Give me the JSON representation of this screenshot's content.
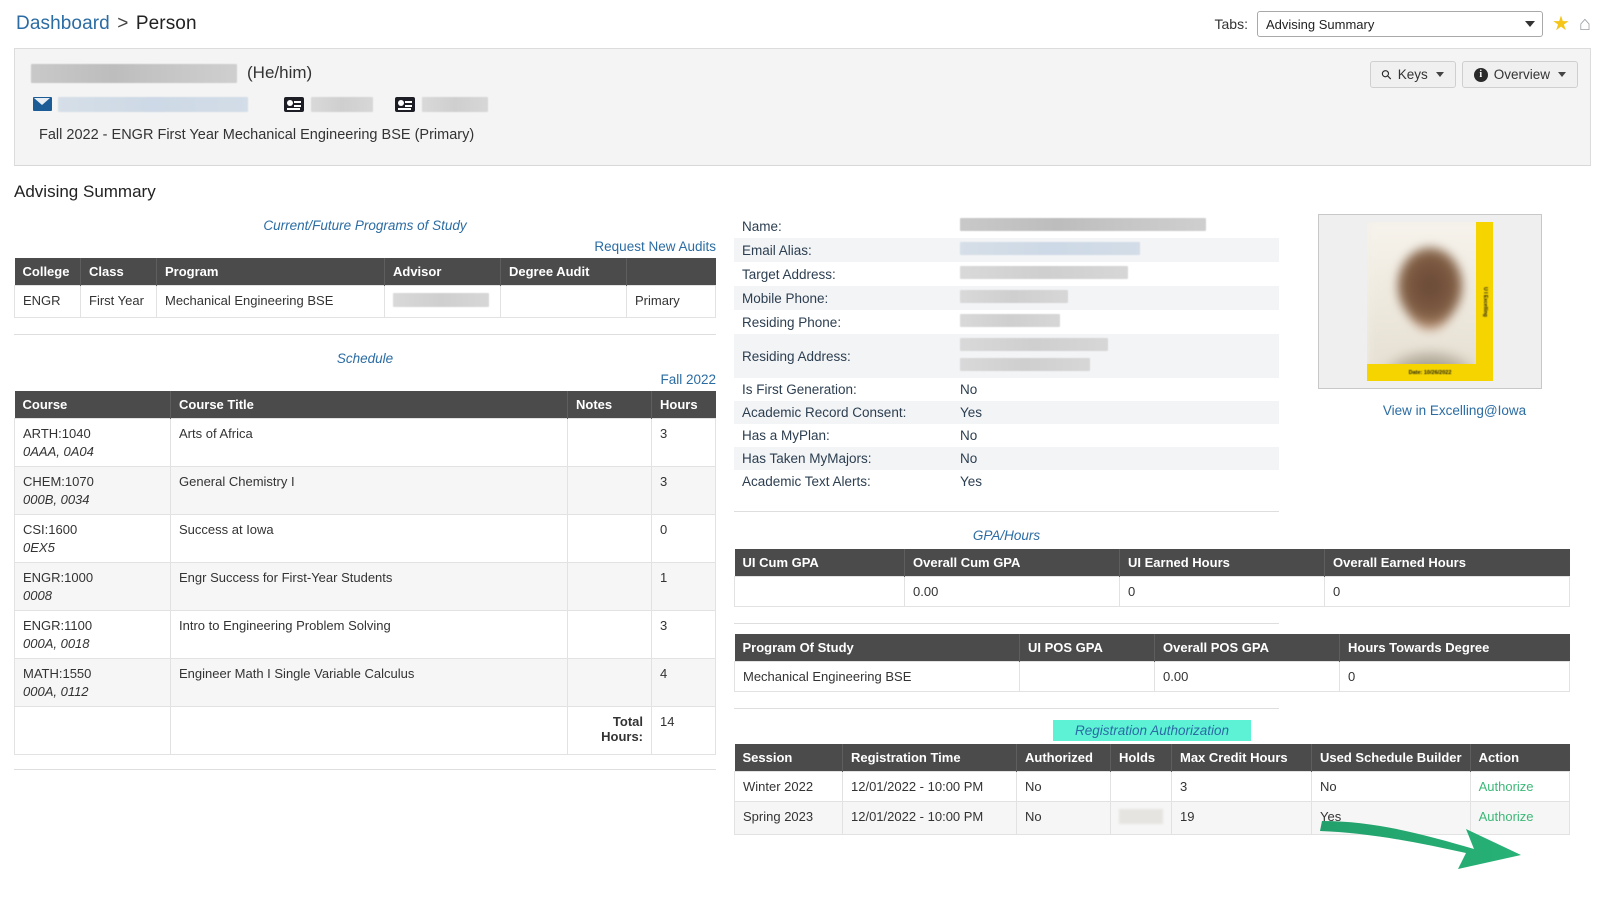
{
  "breadcrumb": {
    "root": "Dashboard",
    "separator": ">",
    "current": "Person"
  },
  "topbar": {
    "tabs_label": "Tabs:",
    "tabs_selected": "Advising Summary",
    "tabs_options": [
      "Advising Summary"
    ],
    "favorite_icon": "star-icon",
    "home_icon": "home-icon"
  },
  "person": {
    "name_redacted": "",
    "pronouns": "(He/him)",
    "email_icon": "envelope-icon",
    "id_icon_1": "id-card-icon",
    "id_icon_2": "id-card-icon",
    "program_line": "Fall 2022 - ENGR First Year Mechanical Engineering BSE (Primary)",
    "keys_button": "Keys",
    "overview_button": "Overview"
  },
  "page": {
    "title": "Advising Summary"
  },
  "programs": {
    "caption": "Current/Future Programs of Study",
    "request_link": "Request New Audits",
    "headers": [
      "College",
      "Class",
      "Program",
      "Advisor",
      "Degree Audit",
      ""
    ],
    "rows": [
      {
        "college": "ENGR",
        "class": "First Year",
        "program": "Mechanical Engineering BSE",
        "advisor": "",
        "degree_audit": "",
        "primary": "Primary"
      }
    ]
  },
  "schedule": {
    "caption": "Schedule",
    "term_link": "Fall 2022",
    "headers": [
      "Course",
      "Course Title",
      "Notes",
      "Hours"
    ],
    "rows": [
      {
        "code": "ARTH:1040",
        "section": "0AAA, 0A04",
        "title": "Arts of Africa",
        "notes": "",
        "hours": "3"
      },
      {
        "code": "CHEM:1070",
        "section": "000B, 0034",
        "title": "General Chemistry I",
        "notes": "",
        "hours": "3"
      },
      {
        "code": "CSI:1600",
        "section": "0EX5",
        "title": "Success at Iowa",
        "notes": "",
        "hours": "0"
      },
      {
        "code": "ENGR:1000",
        "section": "0008",
        "title": "Engr Success for First-Year Students",
        "notes": "",
        "hours": "1"
      },
      {
        "code": "ENGR:1100",
        "section": "000A, 0018",
        "title": "Intro to Engineering Problem Solving",
        "notes": "",
        "hours": "3"
      },
      {
        "code": "MATH:1550",
        "section": "000A, 0112",
        "title": "Engineer Math I Single Variable Calculus",
        "notes": "",
        "hours": "4"
      }
    ],
    "total_label": "Total Hours:",
    "total_hours": "14"
  },
  "info": {
    "rows": [
      {
        "label": "Name:",
        "value": "",
        "redacted": true,
        "blur_width": 246
      },
      {
        "label": "Email Alias:",
        "value": "",
        "redacted": true,
        "blur_width": 180,
        "tint": "blue"
      },
      {
        "label": "Target Address:",
        "value": "",
        "redacted": true,
        "blur_width": 168
      },
      {
        "label": "Mobile Phone:",
        "value": "",
        "redacted": true,
        "blur_width": 108
      },
      {
        "label": "Residing Phone:",
        "value": "",
        "redacted": true,
        "blur_width": 100
      },
      {
        "label": "Residing Address:",
        "value": "",
        "redacted": true,
        "blur_width": 148
      },
      {
        "label": "Is First Generation:",
        "value": "No"
      },
      {
        "label": "Academic Record Consent:",
        "value": "Yes"
      },
      {
        "label": "Has a MyPlan:",
        "value": "No"
      },
      {
        "label": "Has Taken MyMajors:",
        "value": "No"
      },
      {
        "label": "Academic Text Alerts:",
        "value": "Yes"
      }
    ]
  },
  "photo": {
    "side_text": "U I Excelling",
    "date_text": "Date: 10/26/2022",
    "view_link": "View in Excelling@Iowa"
  },
  "gpa": {
    "caption": "GPA/Hours",
    "headers": [
      "UI Cum GPA",
      "Overall Cum GPA",
      "UI Earned Hours",
      "Overall Earned Hours"
    ],
    "rows": [
      {
        "ui_cum_gpa": "",
        "overall_cum_gpa": "0.00",
        "ui_earned_hours": "0",
        "overall_earned_hours": "0"
      }
    ]
  },
  "pos": {
    "headers": [
      "Program Of Study",
      "UI POS GPA",
      "Overall POS GPA",
      "Hours Towards Degree"
    ],
    "rows": [
      {
        "program": "Mechanical Engineering BSE",
        "ui_pos_gpa": "",
        "overall_pos_gpa": "0.00",
        "hours_towards_degree": "0"
      }
    ]
  },
  "registration": {
    "caption": "Registration Authorization",
    "caption_highlight_color": "#5df2d6",
    "headers": [
      "Session",
      "Registration Time",
      "Authorized",
      "Holds",
      "Max Credit Hours",
      "Used Schedule Builder",
      "Action"
    ],
    "rows": [
      {
        "session": "Winter 2022",
        "time": "12/01/2022 - 10:00 PM",
        "authorized": "No",
        "holds": "",
        "max_credit_hours": "3",
        "used_schedule_builder": "No",
        "action": "Authorize"
      },
      {
        "session": "Spring 2023",
        "time": "12/01/2022 - 10:00 PM",
        "authorized": "No",
        "holds": "",
        "holds_redacted": true,
        "max_credit_hours": "19",
        "used_schedule_builder": "Yes",
        "action": "Authorize"
      }
    ]
  },
  "annotation": {
    "arrow_color": "#22a06b",
    "points_to": "Authorize"
  }
}
